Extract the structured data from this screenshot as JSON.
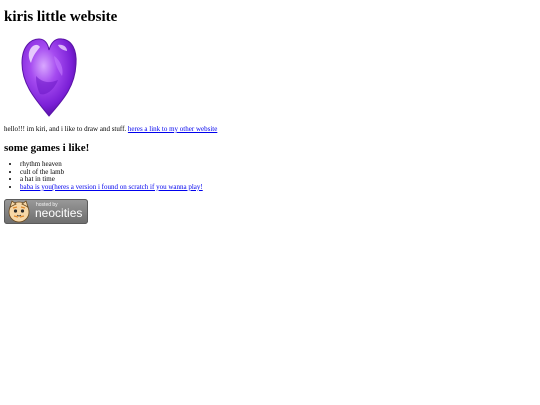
{
  "page": {
    "title": "kiris little website",
    "heart_image": "purple-glass-heart",
    "intro_text": "hello!!! im kiri, and i like to draw and stuff. ",
    "intro_link": "heres a link to my other website",
    "games_heading": "some games i like!",
    "games": [
      {
        "text": "rhythm heaven"
      },
      {
        "text": "cult of the lamb"
      },
      {
        "text": "a hat in time"
      }
    ],
    "games_link": "baba is you(heres a version i found on scratch if you wanna play!"
  },
  "badge": {
    "small_text": "hosted by",
    "big_text": "neocities",
    "mascot": "neocities-cat-icon"
  },
  "colors": {
    "link": "#0000ee",
    "heart_main": "#8a2be2",
    "badge_bg": "#7f7f7f"
  }
}
